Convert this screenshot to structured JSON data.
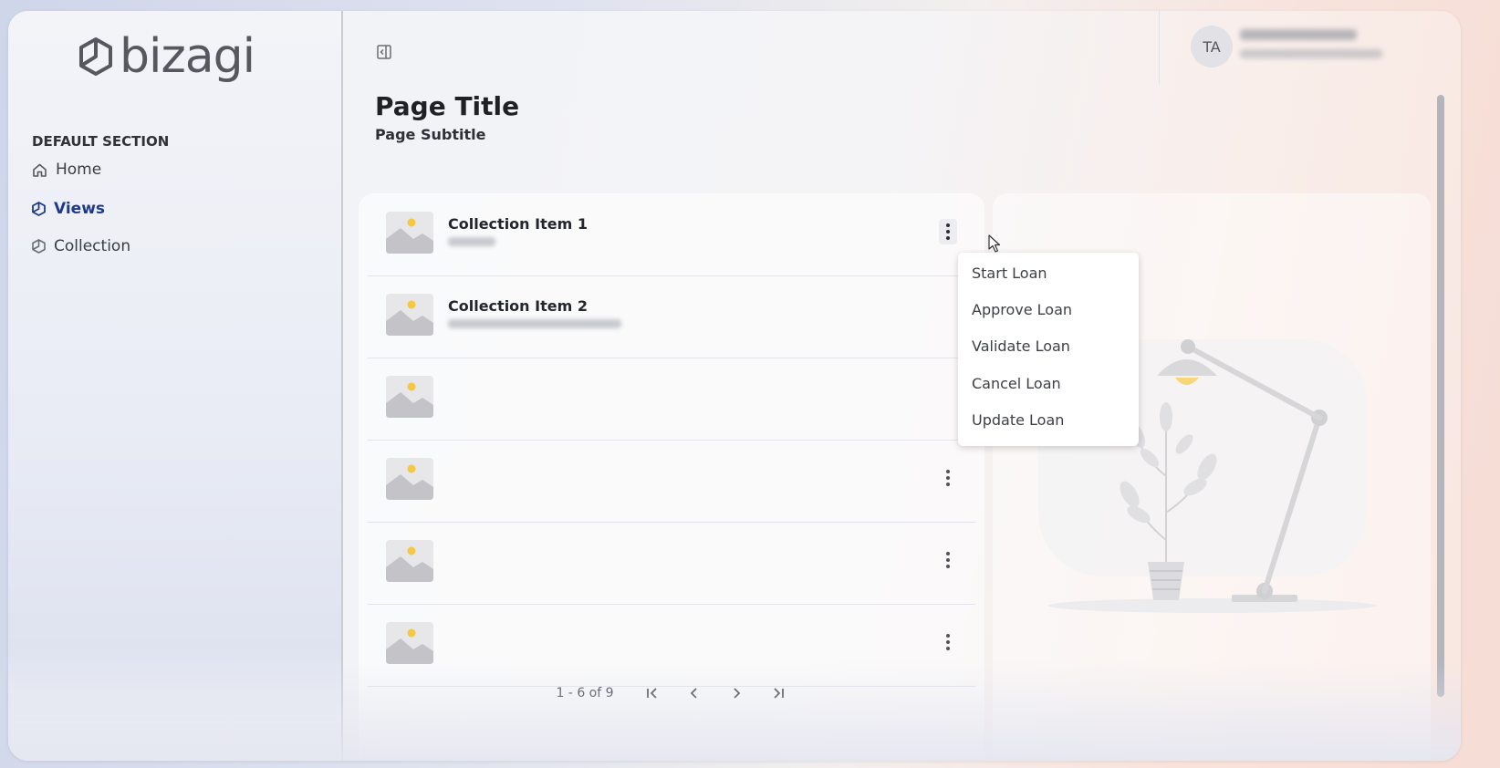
{
  "app": {
    "brand": "bizagi"
  },
  "sidebar": {
    "section_title": "DEFAULT SECTION",
    "items": [
      {
        "label": "Home",
        "icon": "home-icon",
        "active": false
      },
      {
        "label": "Views",
        "icon": "cube-icon",
        "active": true
      },
      {
        "label": "Collection",
        "icon": "cube-icon",
        "active": false
      }
    ]
  },
  "user": {
    "initials": "TA"
  },
  "page": {
    "title": "Page Title",
    "subtitle": "Page Subtitle"
  },
  "list": {
    "items": [
      {
        "title": "Collection Item 1"
      },
      {
        "title": "Collection Item 2"
      },
      {
        "title": ""
      },
      {
        "title": ""
      },
      {
        "title": ""
      },
      {
        "title": ""
      }
    ],
    "pagination": {
      "range": "1 - 6 of 9"
    }
  },
  "dropdown": {
    "items": [
      "Start Loan",
      "Approve Loan",
      "Validate Loan",
      "Cancel Loan",
      "Update Loan"
    ]
  },
  "colors": {
    "accent": "#1f3a8a",
    "text": "#23262c",
    "thumb_sun": "#f5c842"
  }
}
